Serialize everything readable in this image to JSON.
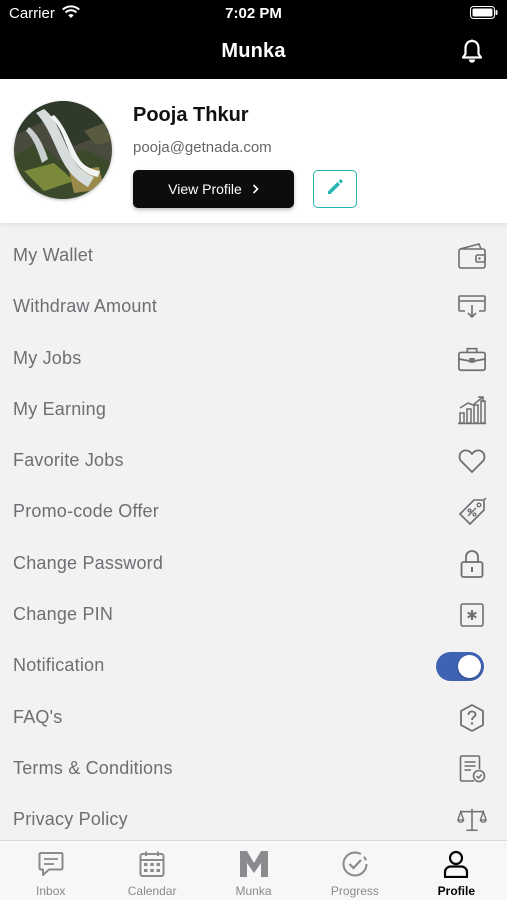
{
  "status_bar": {
    "carrier": "Carrier",
    "time": "7:02 PM"
  },
  "header": {
    "title": "Munka"
  },
  "profile": {
    "name": "Pooja Thkur",
    "email": "pooja@getnada.com",
    "view_profile_label": "View Profile"
  },
  "colors": {
    "accent": "#22b5ad",
    "toggle_on": "#3f63b3",
    "header_bg": "#000000"
  },
  "menu": {
    "items": [
      {
        "label": "My Wallet",
        "icon": "wallet-icon"
      },
      {
        "label": "Withdraw Amount",
        "icon": "withdraw-card-icon"
      },
      {
        "label": "My Jobs",
        "icon": "briefcase-icon"
      },
      {
        "label": "My Earning",
        "icon": "earning-chart-icon"
      },
      {
        "label": "Favorite Jobs",
        "icon": "heart-icon"
      },
      {
        "label": "Promo-code Offer",
        "icon": "promo-tag-icon"
      },
      {
        "label": "Change Password",
        "icon": "lock-icon"
      },
      {
        "label": "Change PIN",
        "icon": "pin-icon"
      },
      {
        "label": "Notification",
        "icon": "toggle",
        "toggle_on": true
      },
      {
        "label": "FAQ's",
        "icon": "question-icon"
      },
      {
        "label": "Terms & Conditions",
        "icon": "document-check-icon"
      },
      {
        "label": "Privacy Policy",
        "icon": "scales-icon"
      }
    ]
  },
  "tabs": [
    {
      "label": "Inbox",
      "icon": "chat-icon",
      "active": false
    },
    {
      "label": "Calendar",
      "icon": "calendar-icon",
      "active": false
    },
    {
      "label": "Munka",
      "icon": "munka-logo-icon",
      "active": false
    },
    {
      "label": "Progress",
      "icon": "progress-check-icon",
      "active": false
    },
    {
      "label": "Profile",
      "icon": "person-icon",
      "active": true
    }
  ]
}
